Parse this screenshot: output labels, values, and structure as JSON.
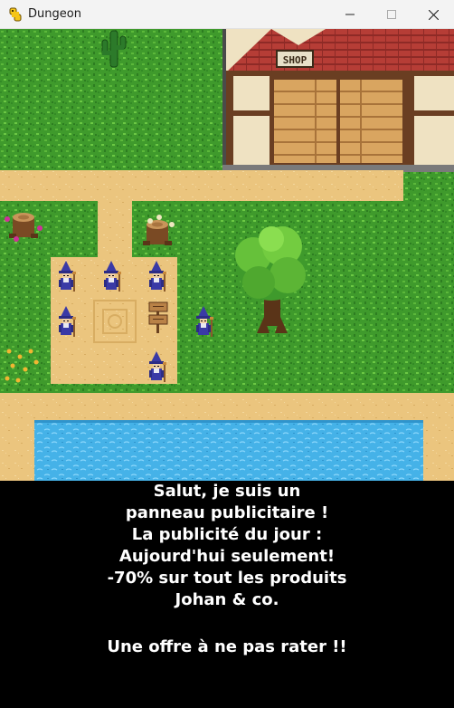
{
  "window": {
    "title": "Dungeon",
    "app_icon": "python-snake-icon",
    "buttons": [
      "minimize-icon",
      "maximize-icon",
      "close-icon"
    ]
  },
  "scene": {
    "shop_sign": "SHOP",
    "colors": {
      "grass": "#3f9a2c",
      "sand": "#ebc57e",
      "water": "#4fb8ea",
      "roof": "#b63d36",
      "wall": "#efe2c2",
      "door": "#d9a560",
      "wizard": "#3a3aa6"
    }
  },
  "dialog": {
    "lines": [
      "Salut, je suis un",
      "panneau publicitaire !",
      "La publicité du jour :",
      "Aujourd'hui seulement!",
      "-70% sur tout les produits",
      "Johan & co.",
      "",
      "Une offre à ne pas rater !!"
    ]
  }
}
